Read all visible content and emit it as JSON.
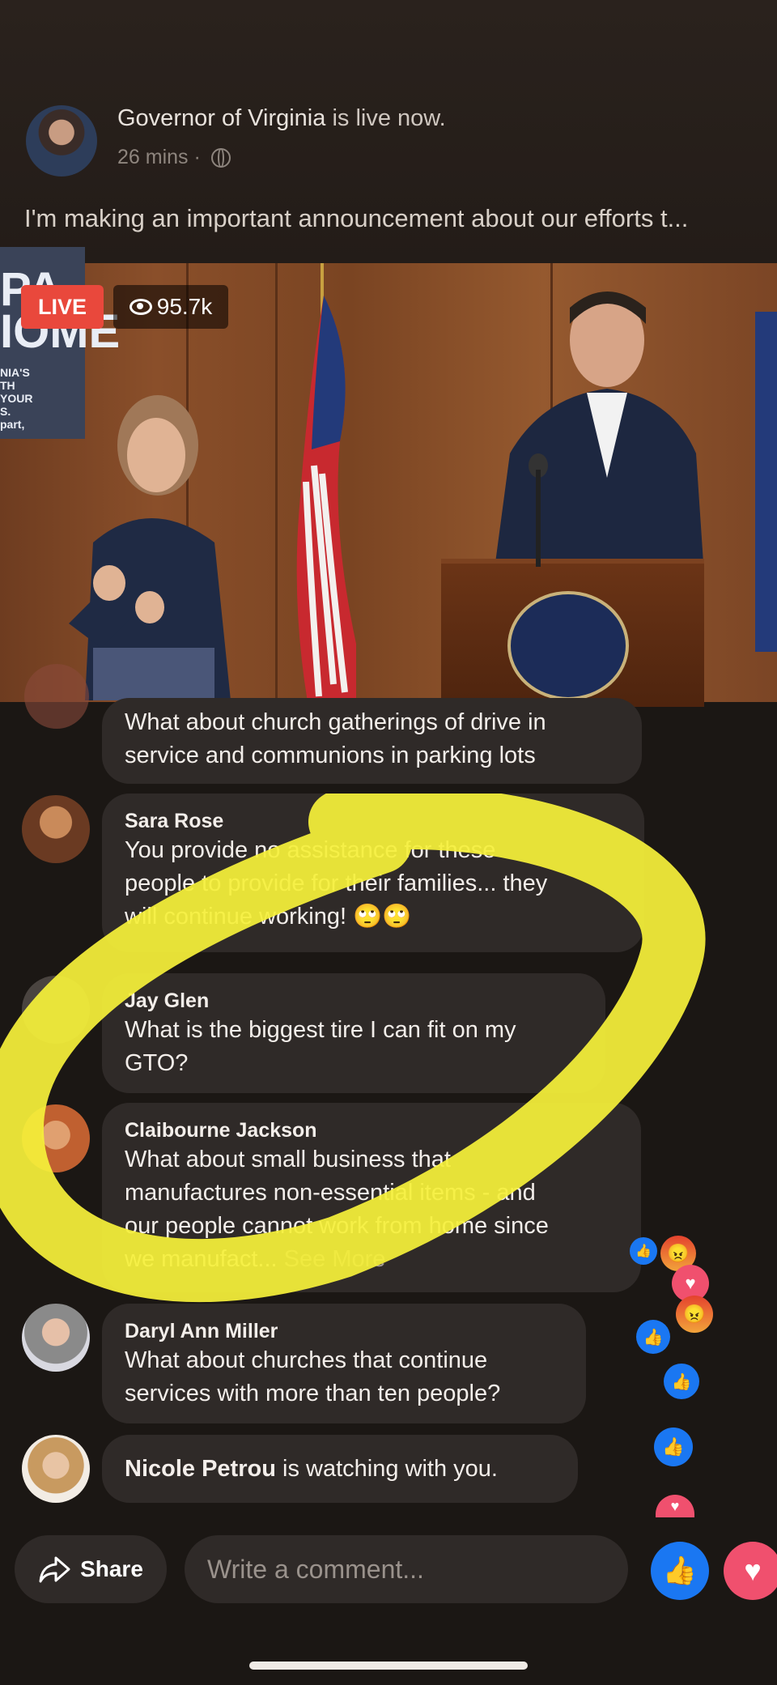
{
  "header": {
    "host_name": "Governor of Virginia",
    "status_text": "is live now.",
    "time_ago": "26 mins",
    "separator": "·",
    "privacy_icon": "globe-icon",
    "caption": "I'm making an important announcement about our efforts t..."
  },
  "video": {
    "live_label": "LIVE",
    "viewer_count": "95.7k",
    "viewer_icon": "eye-icon",
    "banner_big": "PA\nIOME",
    "banner_small": "NIA'S\nTH\nYOUR\nS.\npart,"
  },
  "comments": [
    {
      "name": "",
      "text_lines": [
        "What about church gatherings of drive in",
        "service and communions in parking lots"
      ]
    },
    {
      "name": "Sara Rose",
      "text_lines": [
        "You provide no assistance for these",
        "people to provide for their families... they",
        "will continue working! 🙄🙄"
      ]
    },
    {
      "name": "Jay Glen",
      "text_lines": [
        "What is the biggest tire I can fit on my",
        "GTO?"
      ]
    },
    {
      "name": "Claibourne Jackson",
      "text_lines": [
        "What about small business that",
        "manufactures non-essential items - and",
        "our people cannot work from home since",
        "we manufact..."
      ],
      "see_more": "See More"
    },
    {
      "name": "Daryl Ann Miller",
      "text_lines": [
        "What about churches that continue",
        "services with more than ten people?"
      ]
    },
    {
      "name": "Nicole Petrou",
      "suffix": "is watching with you."
    }
  ],
  "footer": {
    "share_label": "Share",
    "share_icon": "share-arrow-icon",
    "comment_placeholder": "Write a comment...",
    "like_icon": "like-icon",
    "love_icon": "love-icon"
  },
  "colors": {
    "live_red": "#e9483c",
    "like_blue": "#1a77f2",
    "love_pink": "#f0506e",
    "highlight_yellow": "#f5f03a",
    "bubble_bg": "#2f2a28"
  }
}
